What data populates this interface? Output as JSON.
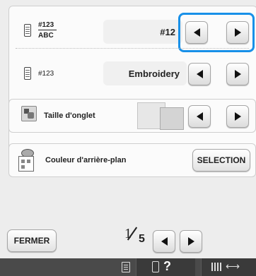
{
  "rows": {
    "thread_display": {
      "label_top": "#123",
      "label_bottom": "ABC",
      "value": "#12"
    },
    "thread_code": {
      "label": "#123",
      "value": "Embroidery"
    },
    "tab_size": {
      "label": "Taille d'onglet"
    },
    "background_color": {
      "label": "Couleur d'arrière-plan",
      "button": "SELECTION"
    }
  },
  "footer": {
    "close_button": "FERMER",
    "page_current": "1",
    "page_total": "5"
  },
  "bottom_bar": {
    "help_label": "?"
  },
  "colors": {
    "highlight": "#1890e8",
    "bar": "#4a4a4a"
  }
}
